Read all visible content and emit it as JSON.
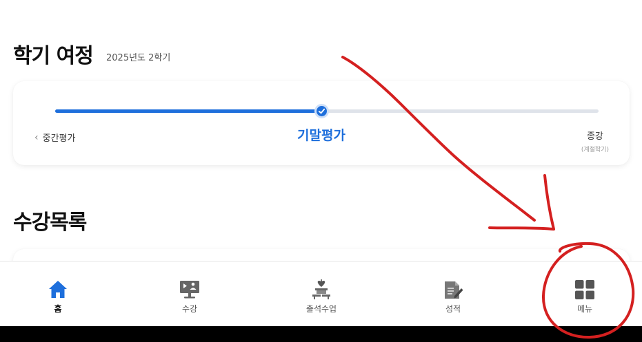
{
  "journey": {
    "title": "학기 여정",
    "semester": "2025년도 2학기",
    "progress_fraction": 0.49,
    "prev_stage": "중간평가",
    "current_stage": "기말평가",
    "next_stage": "종강",
    "next_stage_sub": "(계절학기)"
  },
  "courses": {
    "title": "수강목록"
  },
  "nav": {
    "items": [
      {
        "label": "홈",
        "icon": "home-icon",
        "active": true
      },
      {
        "label": "수강",
        "icon": "lecture-monitor-icon",
        "active": false
      },
      {
        "label": "출석수업",
        "icon": "classroom-desk-icon",
        "active": false
      },
      {
        "label": "성적",
        "icon": "grade-report-icon",
        "active": false
      },
      {
        "label": "메뉴",
        "icon": "grid-menu-icon",
        "active": false
      }
    ]
  },
  "colors": {
    "accent": "#1e6fdc",
    "track": "#dfe3ea",
    "annotation": "#d42020"
  }
}
